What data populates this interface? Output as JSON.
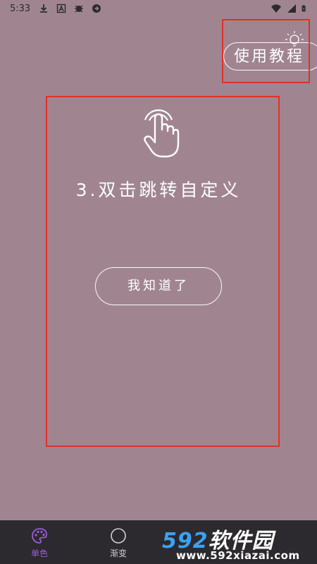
{
  "status_bar": {
    "time": "5:33",
    "left_icons": [
      "download-icon",
      "a-box-icon",
      "bug-icon",
      "circle-app-icon"
    ],
    "right_icons": [
      "wifi-icon",
      "signal-icon",
      "battery-icon"
    ]
  },
  "header": {
    "tutorial_label": "使用教程"
  },
  "guide": {
    "step_text": "3.双击跳转自定义",
    "confirm_label": "我知道了"
  },
  "bottom_nav": {
    "items": [
      {
        "label": "单色",
        "icon": "palette-icon",
        "active": true
      },
      {
        "label": "渐变",
        "icon": "circle-icon",
        "active": false
      }
    ]
  },
  "watermark": {
    "number": "592",
    "brand": "软件园",
    "url": "www.592xiazai.com"
  },
  "colors": {
    "background": "#a08590",
    "highlight": "#e0302a",
    "nav_bg": "#2c2a2e",
    "active": "#9a5cd6",
    "watermark_blue": "#3aa2f5"
  }
}
